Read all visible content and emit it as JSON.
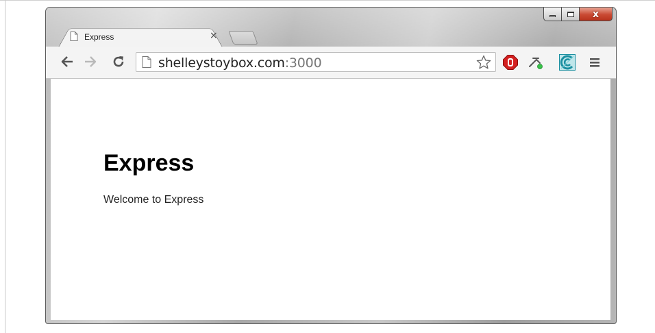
{
  "window": {
    "controls": {
      "minimize": "—",
      "maximize": "□",
      "close": "x"
    }
  },
  "tab": {
    "title": "Express",
    "close_symbol": "×"
  },
  "toolbar": {
    "url_host": "shelleystoybox.com",
    "url_port": ":3000",
    "icons": [
      "back-arrow-icon",
      "forward-arrow-icon",
      "reload-icon",
      "page-icon",
      "star-icon",
      "stop-extension-icon",
      "tool-extension-icon",
      "green-extension-icon",
      "menu-icon"
    ]
  },
  "page": {
    "heading": "Express",
    "text": "Welcome to Express"
  },
  "colors": {
    "close_button": "#c94a33",
    "stop_icon": "#d42020",
    "extension_teal": "#1a8fa0",
    "status_dot": "#39c24a"
  }
}
